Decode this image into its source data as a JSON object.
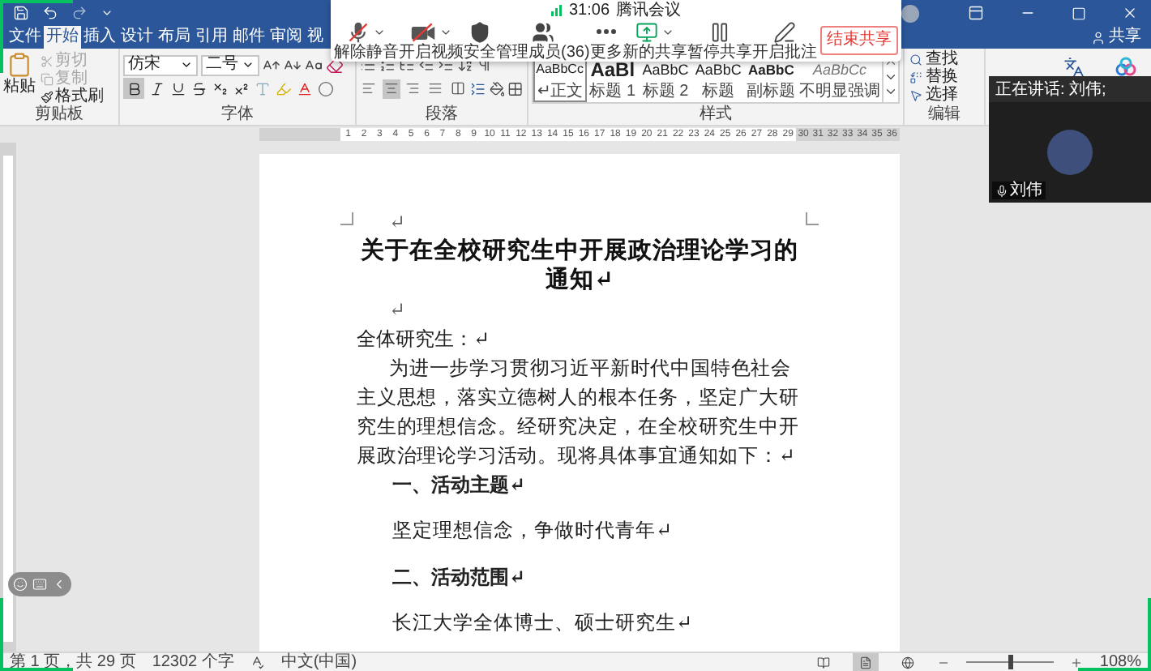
{
  "ribbon_tabs": [
    {
      "label": "文件",
      "selected": false
    },
    {
      "label": "开始",
      "selected": true
    },
    {
      "label": "插入",
      "selected": false
    },
    {
      "label": "设计",
      "selected": false
    },
    {
      "label": "布局",
      "selected": false
    },
    {
      "label": "引用",
      "selected": false
    },
    {
      "label": "邮件",
      "selected": false
    },
    {
      "label": "审阅",
      "selected": false
    },
    {
      "label": "视",
      "selected": false
    }
  ],
  "share_label": "共享",
  "clipboard": {
    "paste": "粘贴",
    "group_label": "剪贴板",
    "items": [
      {
        "kind": "cut",
        "label": "剪切",
        "disabled": true
      },
      {
        "kind": "copy",
        "label": "复制",
        "disabled": true
      },
      {
        "kind": "painter",
        "label": "格式刷",
        "disabled": false
      }
    ]
  },
  "font": {
    "name": "仿宋",
    "size": "二号",
    "bold": true,
    "group_label": "字体"
  },
  "paragraph": {
    "group_label": "段落",
    "align_buttons": [
      {
        "kind": "left",
        "selected": false
      },
      {
        "kind": "center",
        "selected": true
      },
      {
        "kind": "right",
        "selected": false
      },
      {
        "kind": "justify",
        "selected": false
      },
      {
        "kind": "distributed",
        "selected": false
      }
    ]
  },
  "styles": {
    "group_label": "样式",
    "items": [
      {
        "kind": "normal",
        "preview": "AaBbCc",
        "label": "↵正文",
        "selected": true
      },
      {
        "kind": "heading1",
        "preview": "AaBl",
        "label": "标题 1",
        "selected": false
      },
      {
        "kind": "heading2",
        "preview": "AaBbC",
        "label": "标题 2",
        "selected": false
      },
      {
        "kind": "title",
        "preview": "AaBbC",
        "label": "标题",
        "selected": false
      },
      {
        "kind": "subtitle",
        "preview": "AaBbC",
        "label": "副标题",
        "selected": false
      },
      {
        "kind": "emphasis",
        "preview": "AaBbCc",
        "label": "不明显强调",
        "selected": false
      }
    ]
  },
  "editing": {
    "group_label": "编辑",
    "items": [
      {
        "kind": "find",
        "label": "查找"
      },
      {
        "kind": "replace",
        "label": "替换"
      },
      {
        "kind": "select",
        "label": "选择"
      }
    ]
  },
  "ruler": {
    "marks": [
      "1",
      "2",
      "3",
      "4",
      "5",
      "6",
      "7",
      "8",
      "9",
      "10",
      "11",
      "12",
      "13",
      "14",
      "15",
      "16",
      "17",
      "18",
      "19",
      "20",
      "21",
      "22",
      "23",
      "24",
      "25",
      "26",
      "27",
      "28",
      "29",
      "30",
      "31",
      "32",
      "33",
      "34",
      "35",
      "36"
    ]
  },
  "meeting_bar": {
    "timer": "31:06",
    "title": "腾讯会议",
    "end_button": "结束共享",
    "buttons": [
      {
        "kind": "mute",
        "label": "解除静音",
        "dropdown": true
      },
      {
        "kind": "video",
        "label": "开启视频",
        "dropdown": true
      },
      {
        "kind": "security",
        "label": "安全",
        "dropdown": false
      },
      {
        "kind": "members",
        "label": "管理成员(36)",
        "dropdown": false
      },
      {
        "kind": "more",
        "label": "更多",
        "dropdown": false
      },
      {
        "kind": "new_share",
        "label": "新的共享",
        "dropdown": true
      },
      {
        "kind": "pause",
        "label": "暂停共享",
        "dropdown": false
      },
      {
        "kind": "annotate",
        "label": "开启批注",
        "dropdown": false
      }
    ]
  },
  "speaker_panel": {
    "status": "正在讲话: 刘伟;",
    "name": "刘伟"
  },
  "document": {
    "blocks": [
      {
        "kind": "mark",
        "text": "↵"
      },
      {
        "kind": "title",
        "text": "关于在全校研究生中开展政治理论学习的通知↵"
      },
      {
        "kind": "mark",
        "text": "↵"
      },
      {
        "kind": "salutation",
        "text": "全体研究生：↵"
      },
      {
        "kind": "body",
        "text": "为进一步学习贯彻习近平新时代中国特色社会主义思想，落实立德树人的根本任务，坚定广大研究生的理想信念。经研究决定，在全校研究生中开展政治理论学习活动。现将具体事宜通知如下：↵"
      },
      {
        "kind": "heading",
        "text": "一、活动主题↵"
      },
      {
        "kind": "item",
        "text": "坚定理想信念，争做时代青年↵"
      },
      {
        "kind": "heading",
        "text": "二、活动范围↵"
      },
      {
        "kind": "item",
        "text": "长江大学全体博士、硕士研究生↵"
      }
    ]
  },
  "status_bar": {
    "page": "第 1 页，共 29 页",
    "words": "12302 个字",
    "language": "中文(中国)",
    "zoom": "108%",
    "zoom_slider": {
      "level": 0.5
    },
    "views": [
      {
        "kind": "read",
        "selected": false
      },
      {
        "kind": "print",
        "selected": true
      },
      {
        "kind": "web",
        "selected": false
      }
    ]
  }
}
